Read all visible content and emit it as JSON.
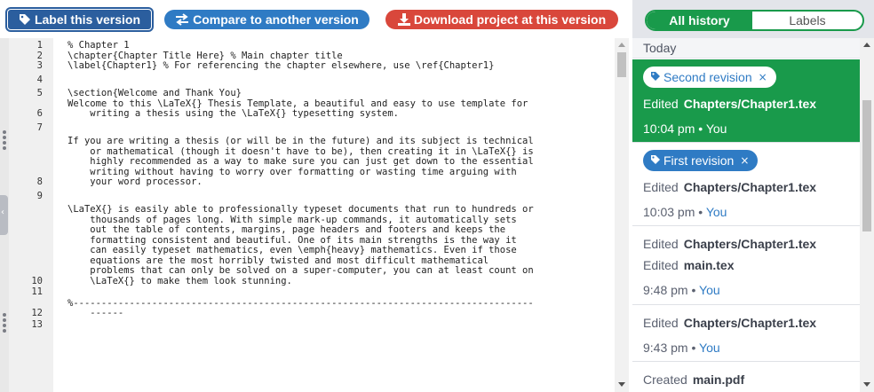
{
  "toolbar": {
    "label_version": "Label this version",
    "compare": "Compare to another version",
    "download": "Download project at this version"
  },
  "history_tabs": {
    "all_history": "All history",
    "labels": "Labels"
  },
  "editor": {
    "lines": [
      {
        "n": "1",
        "text": "% Chapter 1"
      },
      {
        "n": "2",
        "text": "\\chapter{Chapter Title Here} % Main chapter title"
      },
      {
        "n": "3",
        "text": "\\label{Chapter1} % For referencing the chapter elsewhere, use \\ref{Chapter1}"
      },
      {
        "n": "4",
        "text": ""
      },
      {
        "n": "5",
        "text": "\\section{Welcome and Thank You}"
      },
      {
        "n": "6",
        "text": "Welcome to this \\LaTeX{} Thesis Template, a beautiful and easy to use template for\n    writing a thesis using the \\LaTeX{} typesetting system."
      },
      {
        "n": "7",
        "text": ""
      },
      {
        "n": "8",
        "text": "If you are writing a thesis (or will be in the future) and its subject is technical\n    or mathematical (though it doesn't have to be), then creating it in \\LaTeX{} is\n    highly recommended as a way to make sure you can just get down to the essential\n    writing without having to worry over formatting or wasting time arguing with\n    your word processor."
      },
      {
        "n": "9",
        "text": ""
      },
      {
        "n": "10",
        "text": "\\LaTeX{} is easily able to professionally typeset documents that run to hundreds or\n    thousands of pages long. With simple mark-up commands, it automatically sets\n    out the table of contents, margins, page headers and footers and keeps the\n    formatting consistent and beautiful. One of its main strengths is the way it\n    can easily typeset mathematics, even \\emph{heavy} mathematics. Even if those\n    equations are the most horribly twisted and most difficult mathematical\n    problems that can only be solved on a super-computer, you can at least count on\n    \\LaTeX{} to make them look stunning."
      },
      {
        "n": "11",
        "text": ""
      },
      {
        "n": "12",
        "text": "%----------------------------------------------------------------------------------\n    ------"
      },
      {
        "n": "13",
        "text": ""
      }
    ]
  },
  "history": {
    "day": "Today",
    "entries": [
      {
        "label": "Second revision",
        "label_close": "×",
        "edited_word": "Edited",
        "files": [
          "Chapters/Chapter1.tex"
        ],
        "time": "10:04 pm",
        "sep": "•",
        "user": "You",
        "selected": true
      },
      {
        "label": "First revision",
        "label_close": "×",
        "edited_word": "Edited",
        "files": [
          "Chapters/Chapter1.tex"
        ],
        "time": "10:03 pm",
        "sep": "•",
        "user": "You",
        "selected": false
      },
      {
        "edited_word": "Edited",
        "files": [
          "Chapters/Chapter1.tex",
          "main.tex"
        ],
        "time": "9:48 pm",
        "sep": "•",
        "user": "You",
        "selected": false
      },
      {
        "edited_word": "Edited",
        "files": [
          "Chapters/Chapter1.tex"
        ],
        "time": "9:43 pm",
        "sep": "•",
        "user": "You",
        "selected": false
      },
      {
        "edited_word": "Created",
        "files": [
          "main.pdf"
        ],
        "selected": false
      }
    ]
  },
  "colors": {
    "accent_green": "#199a4b",
    "accent_blue": "#2f7bc4",
    "danger_red": "#d9473b",
    "label_btn": "#2b5e9e"
  },
  "icons": {
    "label": "tag-icon",
    "compare": "swap-arrows-icon",
    "download": "download-icon",
    "collapse": "chevron-left-icon"
  }
}
